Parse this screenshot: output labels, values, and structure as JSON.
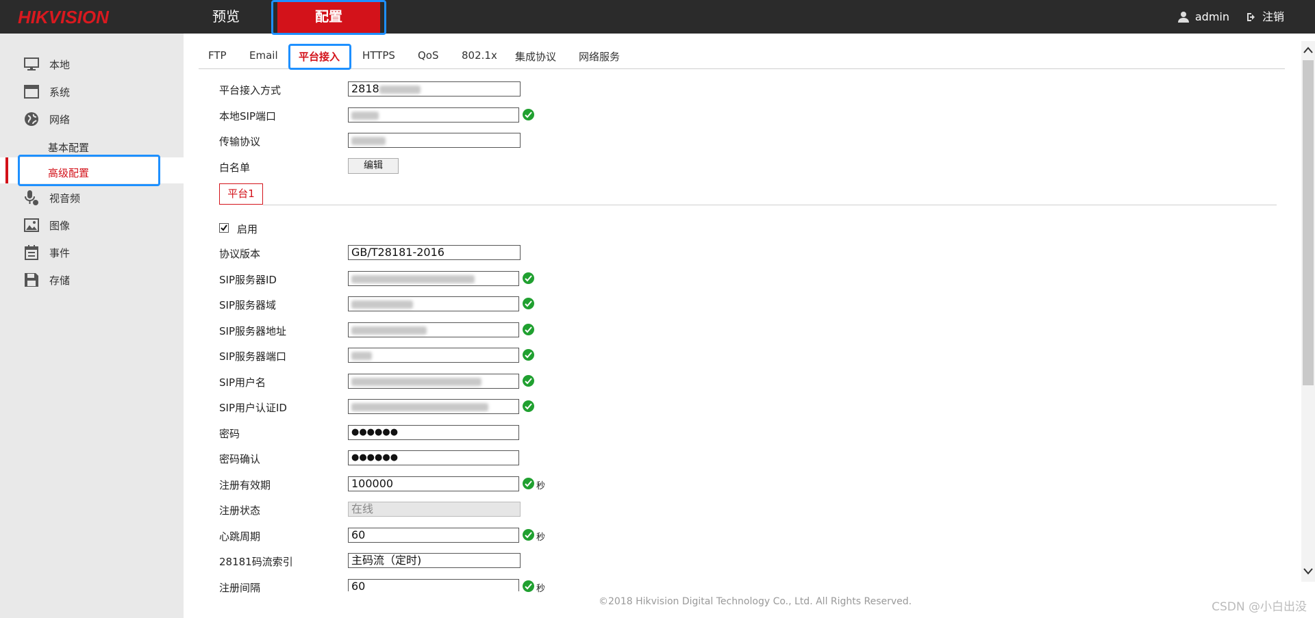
{
  "topbar": {
    "logo": "HIKVISION",
    "nav_preview": "预览",
    "nav_config": "配置",
    "user": "admin",
    "logout": "注销"
  },
  "sidebar": {
    "items": [
      {
        "label": "本地",
        "icon": "monitor-icon"
      },
      {
        "label": "系统",
        "icon": "window-icon"
      },
      {
        "label": "网络",
        "icon": "globe-icon"
      },
      {
        "label": "视音频",
        "icon": "microphone-icon"
      },
      {
        "label": "图像",
        "icon": "image-icon"
      },
      {
        "label": "事件",
        "icon": "calendar-icon"
      },
      {
        "label": "存储",
        "icon": "disk-icon"
      }
    ],
    "network_sub": [
      "基本配置",
      "高级配置"
    ]
  },
  "tabs": [
    "FTP",
    "Email",
    "平台接入",
    "HTTPS",
    "QoS",
    "802.1x",
    "集成协议",
    "网络服务"
  ],
  "form": {
    "access_mode_label": "平台接入方式",
    "access_mode_value": "2818",
    "local_sip_port_label": "本地SIP端口",
    "local_sip_port_value": "5060",
    "transport_label": "传输协议",
    "transport_value": "UDP",
    "whitelist_label": "白名单",
    "edit_button": "编辑",
    "platform_tab": "平台1",
    "enable_label": "启用",
    "protocol_version_label": "协议版本",
    "protocol_version_value": "GB/T28181-2016",
    "sip_server_id_label": "SIP服务器ID",
    "sip_server_domain_label": "SIP服务器域",
    "sip_server_address_label": "SIP服务器地址",
    "sip_server_port_label": "SIP服务器端口",
    "sip_username_label": "SIP用户名",
    "sip_auth_id_label": "SIP用户认证ID",
    "password_label": "密码",
    "password_value": "●●●●●●",
    "password_confirm_label": "密码确认",
    "password_confirm_value": "●●●●●●",
    "reg_validity_label": "注册有效期",
    "reg_validity_value": "100000",
    "reg_status_label": "注册状态",
    "reg_status_value": "在线",
    "heartbeat_label": "心跳周期",
    "heartbeat_value": "60",
    "stream_index_label": "28181码流索引",
    "stream_index_value": "主码流（定时)",
    "reg_interval_label": "注册间隔",
    "reg_interval_value": "60",
    "unit_seconds": "秒"
  },
  "footer": "©2018 Hikvision Digital Technology Co., Ltd. All Rights Reserved.",
  "watermark": "CSDN @小白出没",
  "colors": {
    "accent": "#d3121a",
    "highlight": "#1e90ff",
    "ok": "#20a030",
    "topbar": "#2b2b2b"
  }
}
